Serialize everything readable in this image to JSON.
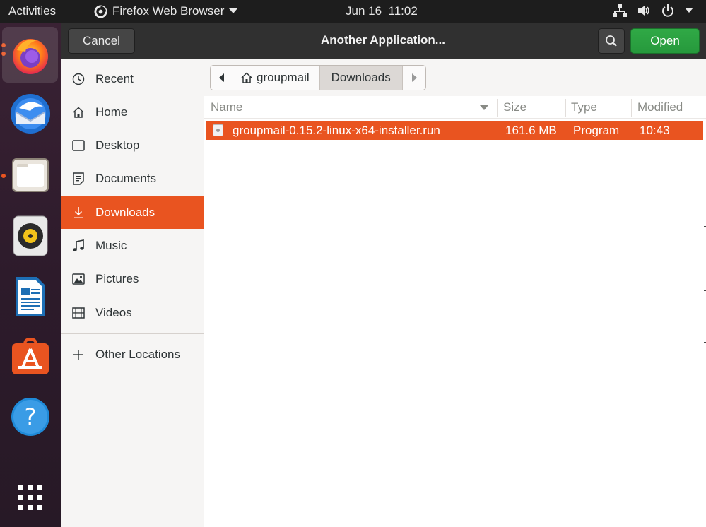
{
  "topbar": {
    "activities": "Activities",
    "app_name": "Firefox Web Browser",
    "date": "Jun 16",
    "time": "11:02"
  },
  "dock": {
    "apps": [
      "firefox-icon",
      "thunderbird-icon",
      "files-icon",
      "rhythmbox-icon",
      "libreoffice-writer-icon",
      "software-center-icon",
      "help-icon",
      "show-apps-icon"
    ]
  },
  "dialog": {
    "cancel_label": "Cancel",
    "title": "Another Application...",
    "open_label": "Open",
    "accent_color": "#e95420",
    "open_color": "#2ea043"
  },
  "sidebar": {
    "items": [
      {
        "label": "Recent",
        "icon": "clock-icon"
      },
      {
        "label": "Home",
        "icon": "home-icon"
      },
      {
        "label": "Desktop",
        "icon": "desktop-icon"
      },
      {
        "label": "Documents",
        "icon": "document-icon"
      },
      {
        "label": "Downloads",
        "icon": "download-icon"
      },
      {
        "label": "Music",
        "icon": "music-icon"
      },
      {
        "label": "Pictures",
        "icon": "picture-icon"
      },
      {
        "label": "Videos",
        "icon": "video-icon"
      }
    ],
    "other_locations": "Other Locations"
  },
  "pathbar": {
    "home_label": "groupmail",
    "current_label": "Downloads"
  },
  "file_list": {
    "columns": [
      "Name",
      "Size",
      "Type",
      "Modified"
    ],
    "rows": [
      {
        "name": "groupmail-0.15.2-linux-x64-installer.run",
        "size": "161.6 MB",
        "type": "Program",
        "modified": "10:43"
      }
    ]
  }
}
